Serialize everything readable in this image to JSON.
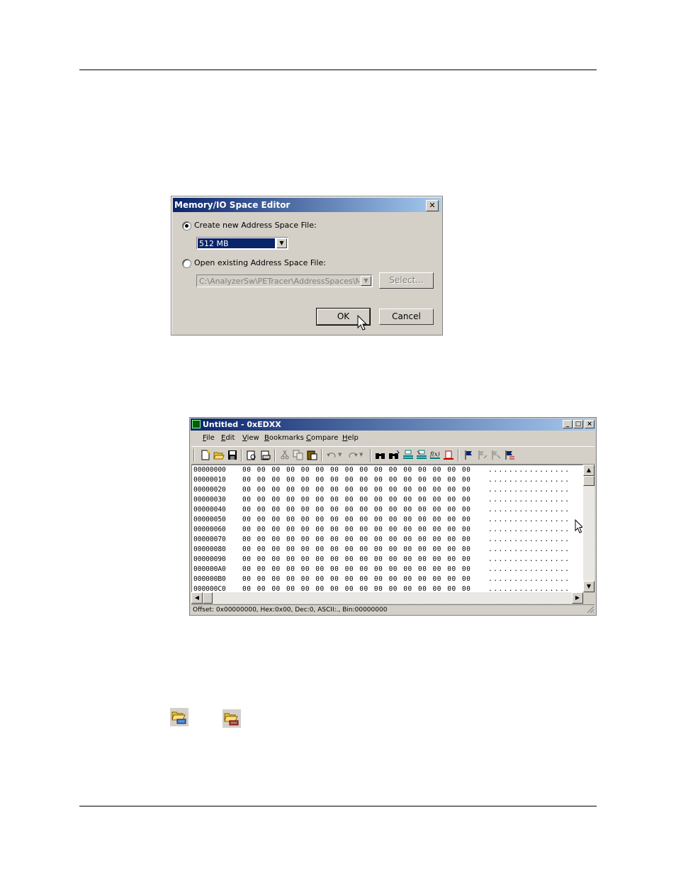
{
  "dialog": {
    "title": "Memory/IO Space Editor",
    "create_label": "Create new Address Space File:",
    "size_value": "512 MB",
    "open_label": "Open existing Address Space File:",
    "path_value": "C:\\AnalyzerSw\\PETracer\\AddressSpaces\\Me",
    "select_label": "Select...",
    "ok_label": "OK",
    "cancel_label": "Cancel",
    "close_glyph": "✕"
  },
  "hexeditor": {
    "title": "Untitled - 0xEDXX",
    "caption_buttons": [
      "_",
      "□",
      "×"
    ],
    "menu": [
      {
        "ul": "F",
        "rest": "ile"
      },
      {
        "ul": "E",
        "rest": "dit"
      },
      {
        "ul": "V",
        "rest": "iew"
      },
      {
        "ul": "B",
        "rest": "ookmarks"
      },
      {
        "ul": "C",
        "rest": "ompare"
      },
      {
        "ul": "H",
        "rest": "elp"
      }
    ],
    "rows": [
      {
        "offset": "00000000",
        "bytes": "00 00 00 00 00 00 00 00 00 00 00 00 00 00 00 00",
        "ascii": "................"
      },
      {
        "offset": "00000010",
        "bytes": "00 00 00 00 00 00 00 00 00 00 00 00 00 00 00 00",
        "ascii": "................"
      },
      {
        "offset": "00000020",
        "bytes": "00 00 00 00 00 00 00 00 00 00 00 00 00 00 00 00",
        "ascii": "................"
      },
      {
        "offset": "00000030",
        "bytes": "00 00 00 00 00 00 00 00 00 00 00 00 00 00 00 00",
        "ascii": "................"
      },
      {
        "offset": "00000040",
        "bytes": "00 00 00 00 00 00 00 00 00 00 00 00 00 00 00 00",
        "ascii": "................"
      },
      {
        "offset": "00000050",
        "bytes": "00 00 00 00 00 00 00 00 00 00 00 00 00 00 00 00",
        "ascii": "................"
      },
      {
        "offset": "00000060",
        "bytes": "00 00 00 00 00 00 00 00 00 00 00 00 00 00 00 00",
        "ascii": "................"
      },
      {
        "offset": "00000070",
        "bytes": "00 00 00 00 00 00 00 00 00 00 00 00 00 00 00 00",
        "ascii": "................"
      },
      {
        "offset": "00000080",
        "bytes": "00 00 00 00 00 00 00 00 00 00 00 00 00 00 00 00",
        "ascii": "................"
      },
      {
        "offset": "00000090",
        "bytes": "00 00 00 00 00 00 00 00 00 00 00 00 00 00 00 00",
        "ascii": "................"
      },
      {
        "offset": "000000A0",
        "bytes": "00 00 00 00 00 00 00 00 00 00 00 00 00 00 00 00",
        "ascii": "................"
      },
      {
        "offset": "000000B0",
        "bytes": "00 00 00 00 00 00 00 00 00 00 00 00 00 00 00 00",
        "ascii": "................"
      },
      {
        "offset": "000000C0",
        "bytes": "00 00 00 00 00 00 00 00 00 00 00 00 00 00 00 00",
        "ascii": "................"
      }
    ],
    "status": "Offset: 0x00000000, Hex:0x00, Dec:0, ASCII:., Bin:00000000"
  },
  "colors": {
    "titlebar": "#0a246a",
    "face": "#d4d0c8"
  }
}
